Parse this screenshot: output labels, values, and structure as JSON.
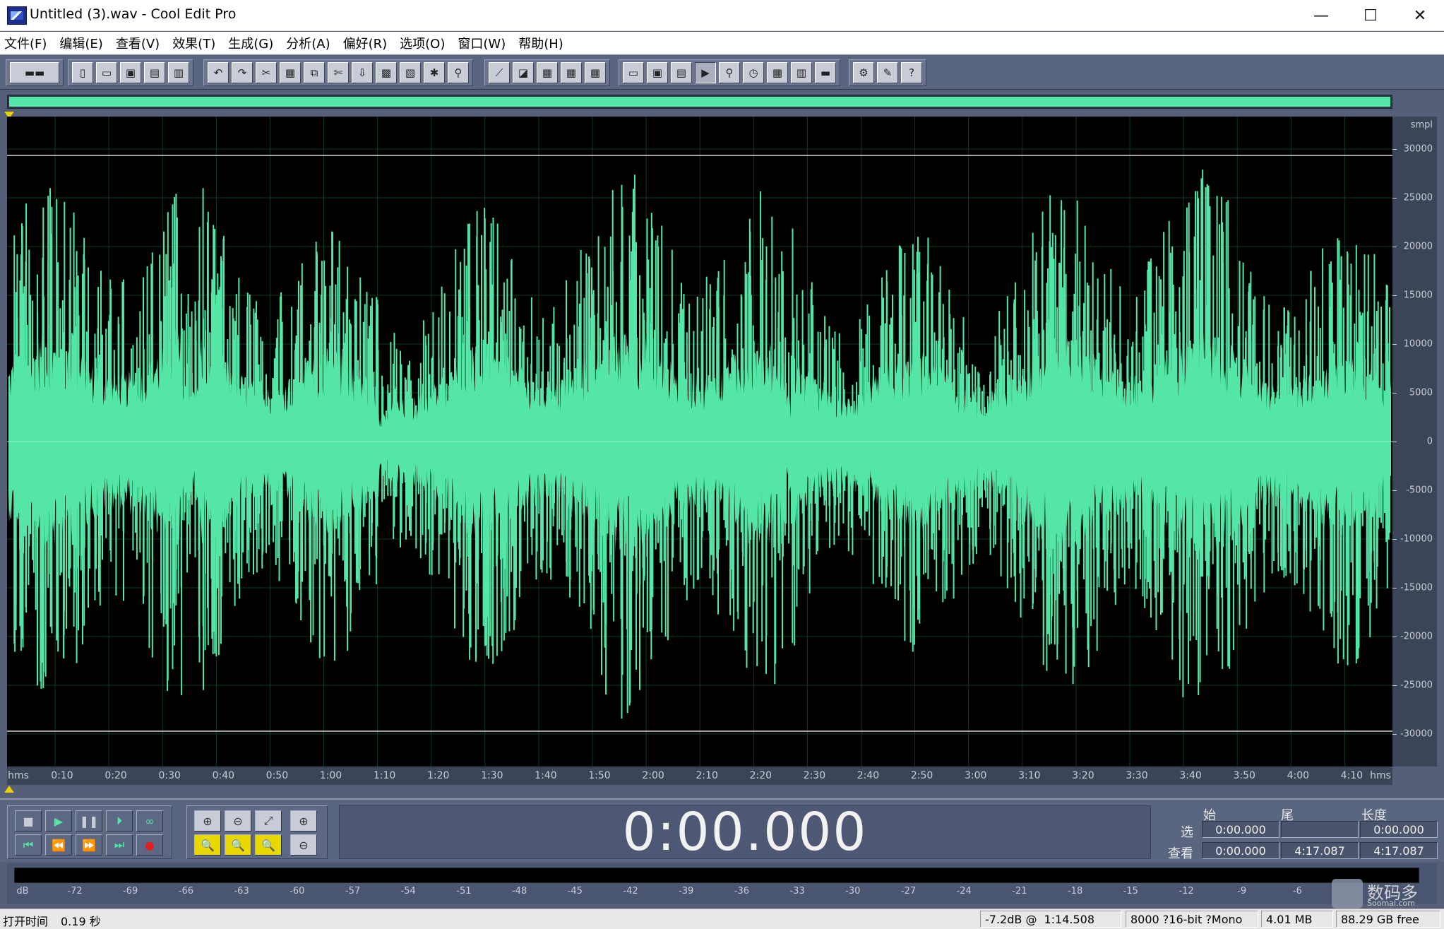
{
  "window": {
    "title": "Untitled (3).wav - Cool Edit Pro",
    "controls": {
      "minimize": "—",
      "maximize": "☐",
      "close": "✕"
    }
  },
  "menu": [
    {
      "label": "文件(F)"
    },
    {
      "label": "编辑(E)"
    },
    {
      "label": "查看(V)"
    },
    {
      "label": "效果(T)"
    },
    {
      "label": "生成(G)"
    },
    {
      "label": "分析(A)"
    },
    {
      "label": "偏好(R)"
    },
    {
      "label": "选项(O)"
    },
    {
      "label": "窗口(W)"
    },
    {
      "label": "帮助(H)"
    }
  ],
  "toolbar_groups": [
    {
      "icons": [
        "multitrack-view-icon"
      ]
    },
    {
      "icons": [
        "new-file-icon",
        "open-file-icon",
        "save-icon",
        "save-all-icon",
        "save-selection-icon"
      ]
    },
    {
      "icons": [
        "undo-icon",
        "redo-icon",
        "cut-trim-icon",
        "copy-new-icon",
        "copy-icon",
        "cut-icon",
        "paste-icon",
        "paste-new-icon",
        "mix-paste-icon",
        "paste-to-file-icon",
        "play-clip-icon"
      ]
    },
    {
      "icons": [
        "envelope-icon",
        "amplify-icon",
        "multi-select-icon",
        "multi-select-2-icon",
        "multi-select-3-icon"
      ]
    },
    {
      "icons": [
        "waveform-view-icon",
        "spectral-view-icon",
        "cue-list-icon",
        "play-list-icon",
        "frequency-analysis-icon",
        "time-display-icon",
        "grid-icon",
        "level-meter-icon",
        "status-bar-icon"
      ]
    },
    {
      "icons": [
        "settings-icon",
        "tools-icon",
        "help-icon"
      ]
    }
  ],
  "waveform": {
    "color": "#54e6a6",
    "background": "#000000",
    "amplitude_unit": "smpl",
    "amplitude_ticks": [
      "30000",
      "25000",
      "20000",
      "15000",
      "10000",
      "5000",
      "0",
      "-5000",
      "-10000",
      "-15000",
      "-20000",
      "-25000",
      "-30000"
    ],
    "time_unit_left": "hms",
    "time_unit_right": "hms",
    "time_ticks": [
      "0:10",
      "0:20",
      "0:30",
      "0:40",
      "0:50",
      "1:00",
      "1:10",
      "1:20",
      "1:30",
      "1:40",
      "1:50",
      "2:00",
      "2:10",
      "2:20",
      "2:30",
      "2:40",
      "2:50",
      "3:00",
      "3:10",
      "3:20",
      "3:30",
      "3:40",
      "3:50",
      "4:00",
      "4:10"
    ]
  },
  "transport": {
    "buttons": [
      {
        "name": "stop-icon",
        "glyph": "■"
      },
      {
        "name": "play-icon",
        "glyph": "▶"
      },
      {
        "name": "pause-icon",
        "glyph": "❚❚"
      },
      {
        "name": "play-to-end-icon",
        "glyph": "⏵"
      },
      {
        "name": "loop-icon",
        "glyph": "∞"
      },
      {
        "name": "go-start-icon",
        "glyph": "⏮"
      },
      {
        "name": "rewind-icon",
        "glyph": "⏪"
      },
      {
        "name": "fast-forward-icon",
        "glyph": "⏩"
      },
      {
        "name": "go-end-icon",
        "glyph": "⏭"
      },
      {
        "name": "record-icon",
        "glyph": "●"
      }
    ],
    "zoom_buttons": [
      {
        "name": "zoom-in-icon",
        "glyph": "⊕"
      },
      {
        "name": "zoom-out-icon",
        "glyph": "⊖"
      },
      {
        "name": "zoom-full-icon",
        "glyph": "⤢"
      },
      {
        "name": "zoom-in-left-icon",
        "glyph": "🔍"
      },
      {
        "name": "zoom-in-right-icon",
        "glyph": "🔍"
      },
      {
        "name": "zoom-selection-icon",
        "glyph": "🔍"
      },
      {
        "name": "zoom-vertical-in-icon",
        "glyph": "⊕"
      },
      {
        "name": "zoom-vertical-out-icon",
        "glyph": "⊖"
      }
    ],
    "time_display": "0:00.000"
  },
  "selection": {
    "col_start": "始",
    "col_end": "尾",
    "col_length": "长度",
    "row_select": "选",
    "row_view": "查看",
    "select_start": "0:00.000",
    "select_end": "",
    "select_length": "0:00.000",
    "view_start": "0:00.000",
    "view_end": "4:17.087",
    "view_length": "4:17.087"
  },
  "level_meter": {
    "unit": "dB",
    "ticks": [
      "-72",
      "-69",
      "-66",
      "-63",
      "-60",
      "-57",
      "-54",
      "-51",
      "-48",
      "-45",
      "-42",
      "-39",
      "-36",
      "-33",
      "-30",
      "-27",
      "-24",
      "-21",
      "-18",
      "-15",
      "-12",
      "-9",
      "-6"
    ]
  },
  "status": {
    "open_time_label": "打开时间",
    "open_time_value": "0.19 秒",
    "level_at": "-7.2dB @",
    "cursor_time": "1:14.508",
    "format": "8000 ?16-bit ?Mono",
    "file_size": "4.01 MB",
    "free_space": "88.29 GB free"
  },
  "watermark": {
    "text": "数码多",
    "sub": "Soomal.com"
  }
}
